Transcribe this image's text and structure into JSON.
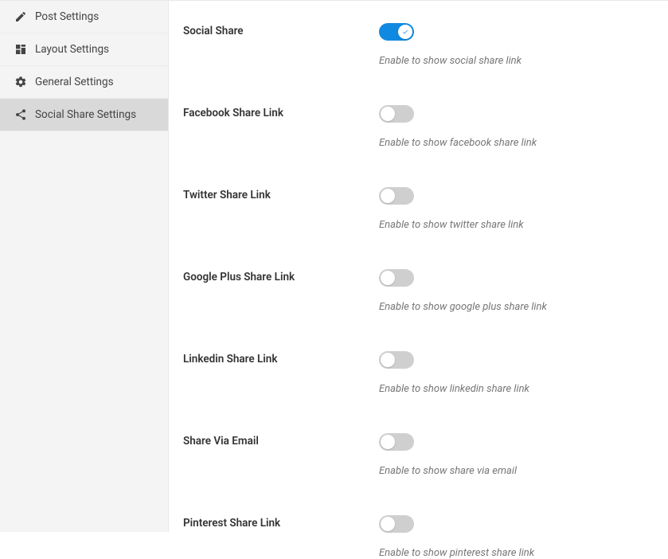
{
  "sidebar": {
    "items": [
      {
        "label": "Post Settings"
      },
      {
        "label": "Layout Settings"
      },
      {
        "label": "General Settings"
      },
      {
        "label": "Social Share Settings"
      }
    ]
  },
  "settings": [
    {
      "label": "Social Share",
      "desc": "Enable to show social share link",
      "on": true
    },
    {
      "label": "Facebook Share Link",
      "desc": "Enable to show facebook share link",
      "on": false
    },
    {
      "label": "Twitter Share Link",
      "desc": "Enable to show twitter share link",
      "on": false
    },
    {
      "label": "Google Plus Share Link",
      "desc": "Enable to show google plus share link",
      "on": false
    },
    {
      "label": "Linkedin Share Link",
      "desc": "Enable to show linkedin share link",
      "on": false
    },
    {
      "label": "Share Via Email",
      "desc": "Enable to show share via email",
      "on": false
    },
    {
      "label": "Pinterest Share Link",
      "desc": "Enable to show pinterest share link",
      "on": false
    }
  ]
}
